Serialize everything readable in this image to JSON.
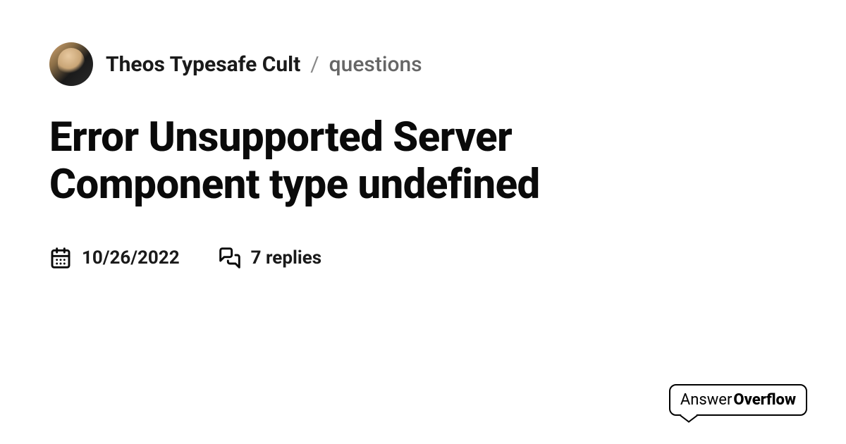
{
  "breadcrumb": {
    "community": "Theos Typesafe Cult",
    "separator": "/",
    "category": "questions"
  },
  "title": "Error Unsupported Server Component type undefined",
  "meta": {
    "date": "10/26/2022",
    "replies": "7 replies"
  },
  "logo": {
    "answer": "Answer",
    "overflow": "Overflow"
  }
}
